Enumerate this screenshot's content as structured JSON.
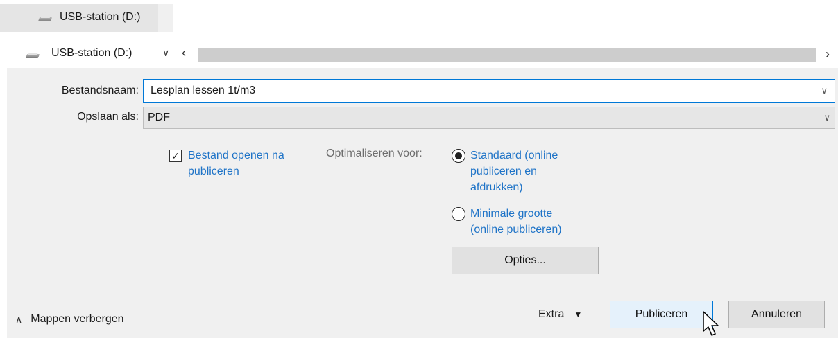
{
  "tree": {
    "selected_item": {
      "label": "USB-station (D:)",
      "icon": "usb-drive-icon"
    }
  },
  "location_bar": {
    "label": "USB-station (D:)",
    "icon": "usb-drive-icon",
    "expand_icon": "chevron-down-icon",
    "scroll_left": "‹",
    "scroll_right": "›"
  },
  "form": {
    "filename_label": "Bestandsnaam:",
    "filename_value": "Lesplan lessen 1t/m3",
    "save_as_label": "Opslaan als:",
    "save_as_value": "PDF"
  },
  "options": {
    "open_after_label_line1": "Bestand openen na",
    "open_after_label_line2": "publiceren",
    "open_after_checked": true,
    "optimize_label": "Optimaliseren voor:",
    "standard_line1": "Standaard (online",
    "standard_line2": "publiceren en",
    "standard_line3": "afdrukken)",
    "standard_selected": true,
    "minimal_line1": "Minimale grootte",
    "minimal_line2": "(online publiceren)",
    "minimal_selected": false,
    "options_button": "Opties..."
  },
  "footer": {
    "hide_folders": "Mappen verbergen",
    "tools": "Extra",
    "publish": "Publiceren",
    "cancel": "Annuleren"
  },
  "colors": {
    "link_blue": "#1e73c7",
    "focus_blue": "#0078d7",
    "panel_gray": "#f0f0f0"
  }
}
